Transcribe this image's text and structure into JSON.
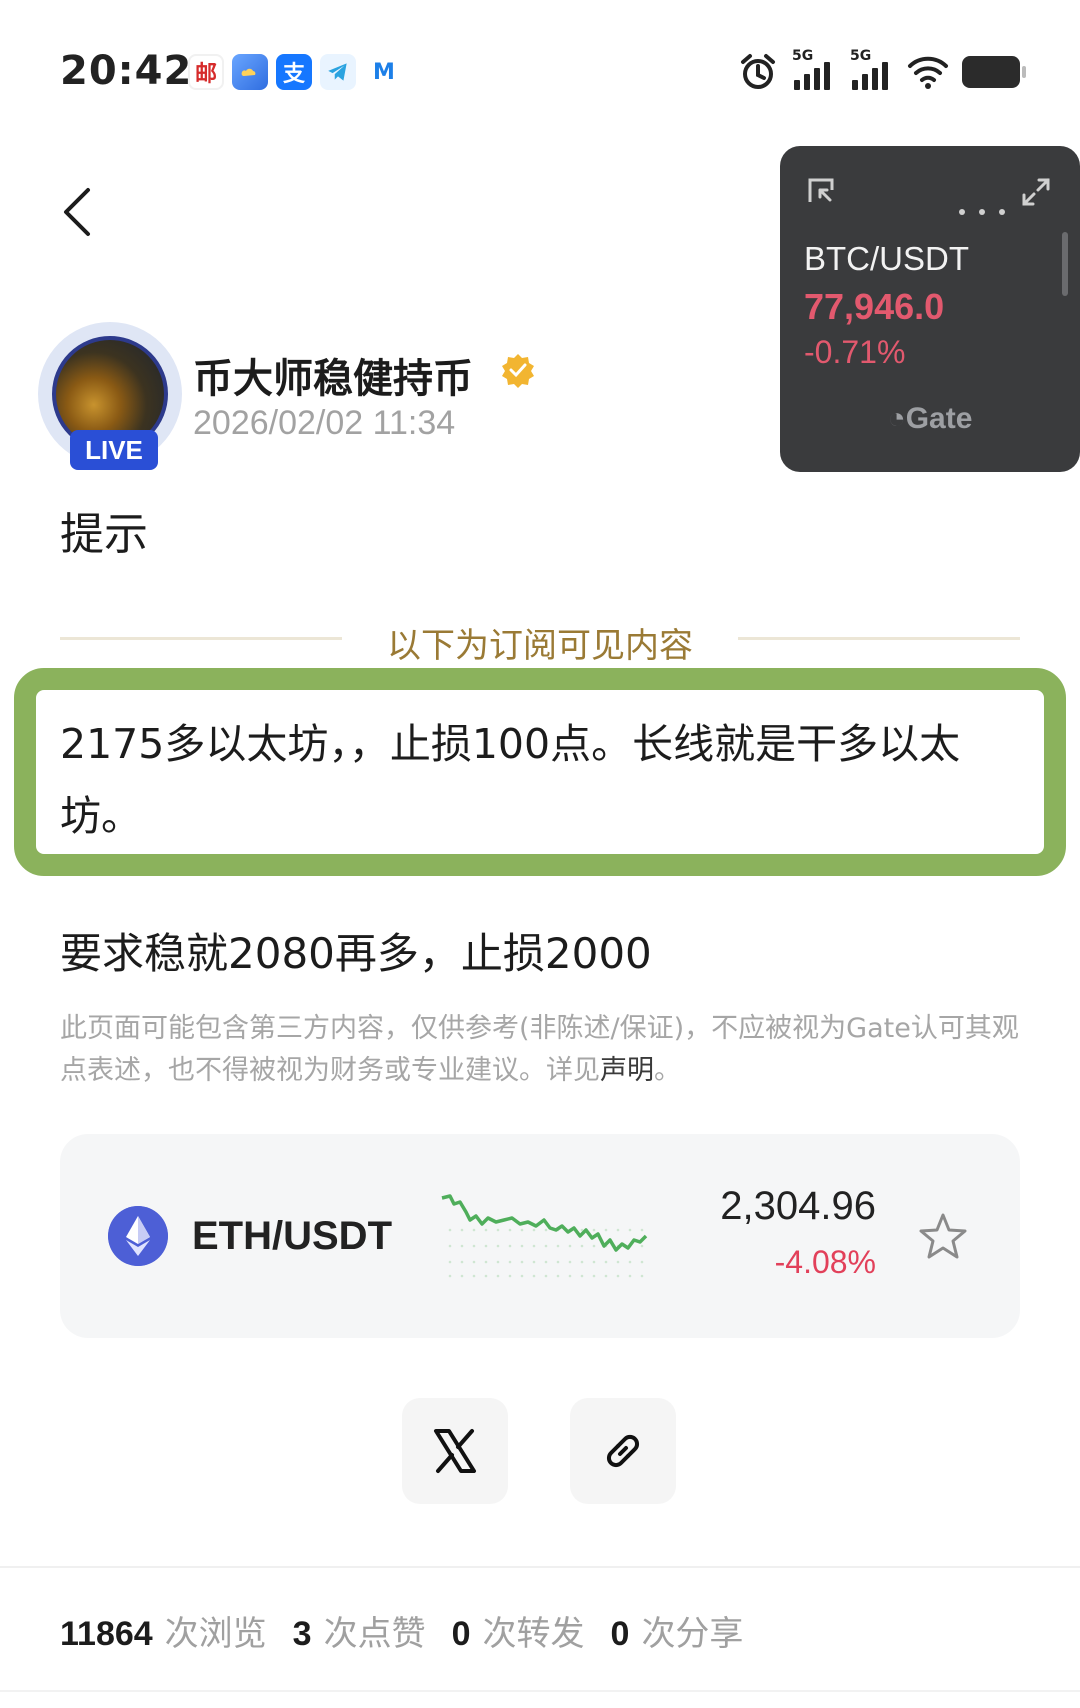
{
  "status_bar": {
    "time": "20:42",
    "app_icons": [
      "mail-app-icon",
      "cloud-app-icon",
      "alipay-icon",
      "telegram-icon",
      "m-app-icon"
    ],
    "alipay_glyph": "支",
    "mail_glyph": "邮",
    "m_glyph": "M",
    "network_labels": [
      "5G",
      "5G"
    ]
  },
  "floating_ticker": {
    "pair": "BTC/USDT",
    "price": "77,946.0",
    "change": "-0.71%",
    "brand": "Gate",
    "colors": {
      "background": "#3a3b3d",
      "negative": "#e2596e"
    }
  },
  "author": {
    "name": "币大师稳健持币",
    "live_badge": "LIVE",
    "post_time": "2026/02/02 11:34"
  },
  "post": {
    "hint": "提示",
    "subscription_divider": "以下为订阅可见内容",
    "subscriber_text": "2175多以太坊，，止损100点。长线就是干多以太坊。",
    "main_line": "要求稳就2080再多，止损2000",
    "disclaimer": "此页面可能包含第三方内容，仅供参考(非陈述/保证)，不应被视为Gate认可其观点表述，也不得被视为财务或专业建议。详见",
    "disclaimer_link": "声明",
    "disclaimer_end": "。"
  },
  "token_card": {
    "pair": "ETH/USDT",
    "price": "2,304.96",
    "change": "-4.08%",
    "colors": {
      "sparkline": "#4fae5b",
      "negative": "#e2405a"
    }
  },
  "stats": [
    {
      "value": "11864",
      "label": "次浏览"
    },
    {
      "value": "3",
      "label": "次点赞"
    },
    {
      "value": "0",
      "label": "次转发"
    },
    {
      "value": "0",
      "label": "次分享"
    }
  ]
}
